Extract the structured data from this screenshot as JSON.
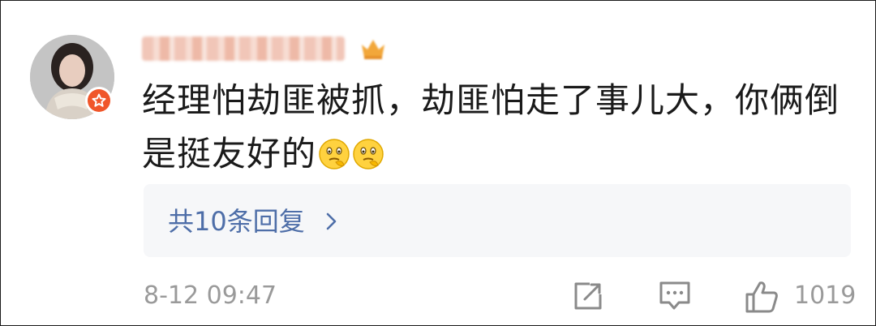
{
  "comment": {
    "username_visible": "",
    "text": "经理怕劫匪被抓，劫匪怕走了事儿大，你俩倒是挺友好的",
    "emojis": [
      "thinking-emoji",
      "thinking-emoji"
    ]
  },
  "replies": {
    "label": "共10条回复"
  },
  "footer": {
    "timestamp": "8-12 09:47",
    "like_count": "1019"
  },
  "colors": {
    "reply_link": "#4e6ea8",
    "meta_gray": "#9a9a9a",
    "badge": "#f0562a",
    "reply_bg": "#f6f7f9"
  }
}
